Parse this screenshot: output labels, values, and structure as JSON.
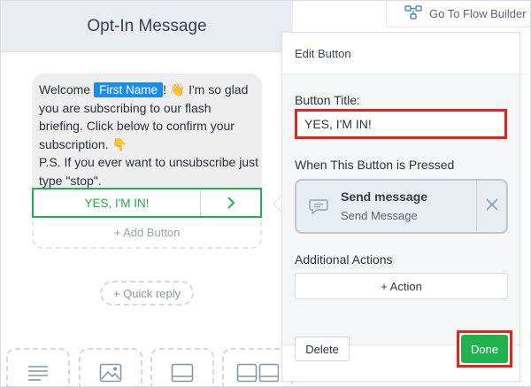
{
  "left_panel": {
    "title": "Opt-In Message",
    "message": {
      "part1": "Welcome ",
      "first_name_chip": "First Name",
      "part2": "! 👋 I'm so glad you are subscribing to our flash briefing. Click below to confirm your subscription. 👇",
      "part3": "P.S. If you ever want to unsubscribe just type \"stop\"."
    },
    "button_label": "YES, I'M IN!",
    "add_button_label": "+ Add Button",
    "quick_reply_label": "+ Quick reply",
    "tiles": [
      {
        "icon": "text-icon"
      },
      {
        "icon": "image-icon"
      },
      {
        "icon": "card-icon"
      },
      {
        "icon": "gallery-icon"
      }
    ]
  },
  "top_right": {
    "flow_builder_label": "Go To Flow Builder",
    "icon": "flow-icon"
  },
  "edit_panel": {
    "title": "Edit Button",
    "button_title_label": "Button Title:",
    "button_title_value": "YES, I'M IN!",
    "pressed_label": "When This Button is Pressed",
    "action": {
      "title": "Send message",
      "subtitle": "Send Message",
      "icon": "chat-bubble-icon"
    },
    "additional_actions_label": "Additional Actions",
    "add_action_label": "+ Action",
    "delete_label": "Delete",
    "done_label": "Done"
  },
  "colors": {
    "accent_green": "#20b24f",
    "chip_blue": "#1a8cf0",
    "highlight_red": "#e8221b"
  }
}
